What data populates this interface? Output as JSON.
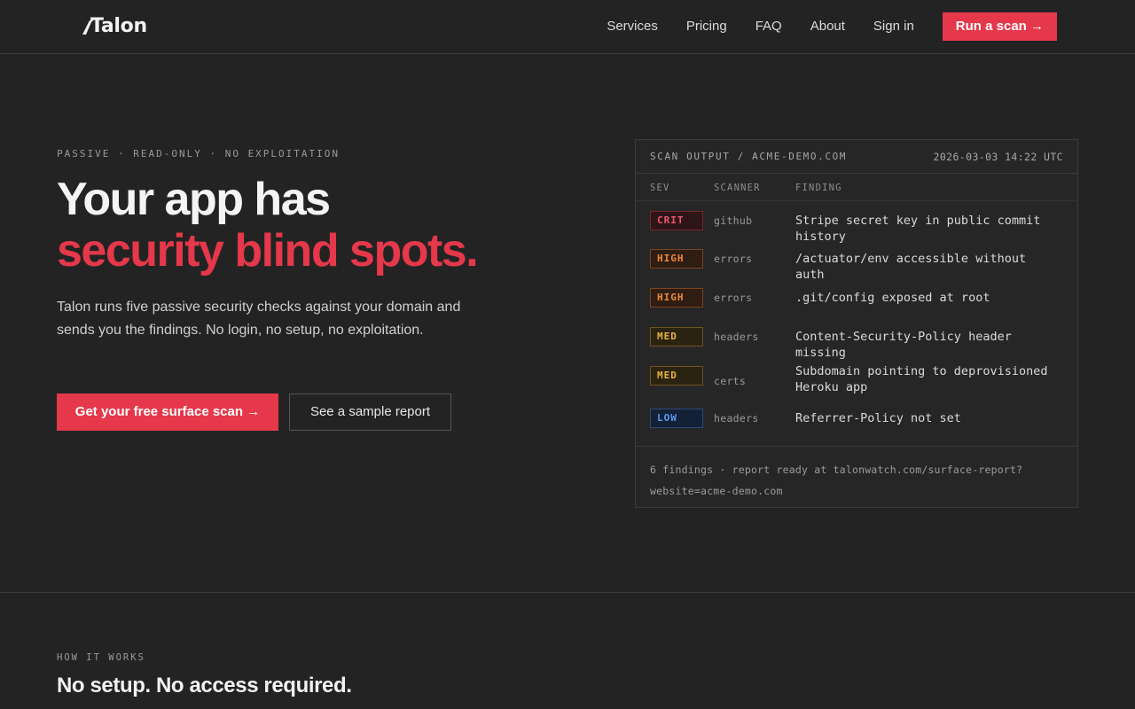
{
  "nav": {
    "logo": "Talon",
    "links": [
      "Services",
      "Pricing",
      "FAQ",
      "About",
      "Sign in"
    ],
    "cta": "Run a scan →"
  },
  "hero": {
    "eyebrow": "PASSIVE · READ-ONLY · NO EXPLOITATION",
    "title_line1": "Your app has",
    "title_line2": "security blind spots.",
    "lede": "Talon runs five passive security checks against your domain and sends you the findings. No login, no setup, no exploitation.",
    "primary_cta": "Get your free surface scan →",
    "secondary_cta": "See a sample report"
  },
  "scan": {
    "title": "SCAN OUTPUT / ACME-DEMO.COM",
    "timestamp": "2026-03-03 14:22 UTC",
    "columns": [
      "SEV",
      "SCANNER",
      "FINDING"
    ],
    "rows": [
      {
        "sev": "CRIT",
        "scanner": "github",
        "finding": "Stripe secret key in public commit history"
      },
      {
        "sev": "HIGH",
        "scanner": "errors",
        "finding": "/actuator/env accessible without auth"
      },
      {
        "sev": "HIGH",
        "scanner": "errors",
        "finding": ".git/config exposed at root"
      },
      {
        "sev": "MED",
        "scanner": "headers",
        "finding": "Content-Security-Policy header missing"
      },
      {
        "sev": "MED",
        "scanner": "certs",
        "finding": "Subdomain pointing to deprovisioned Heroku app"
      },
      {
        "sev": "LOW",
        "scanner": "headers",
        "finding": "Referrer-Policy not set"
      }
    ],
    "footer": "6 findings · report ready at talonwatch.com/surface-report?website=acme-demo.com"
  },
  "how": {
    "eyebrow": "HOW IT WORKS",
    "title": "No setup. No access required."
  },
  "colors": {
    "accent": "#e5384a",
    "background": "#232323",
    "crit": "#f0566a",
    "high": "#f08a3c",
    "med": "#e8b43a",
    "low": "#5b9cf0"
  }
}
